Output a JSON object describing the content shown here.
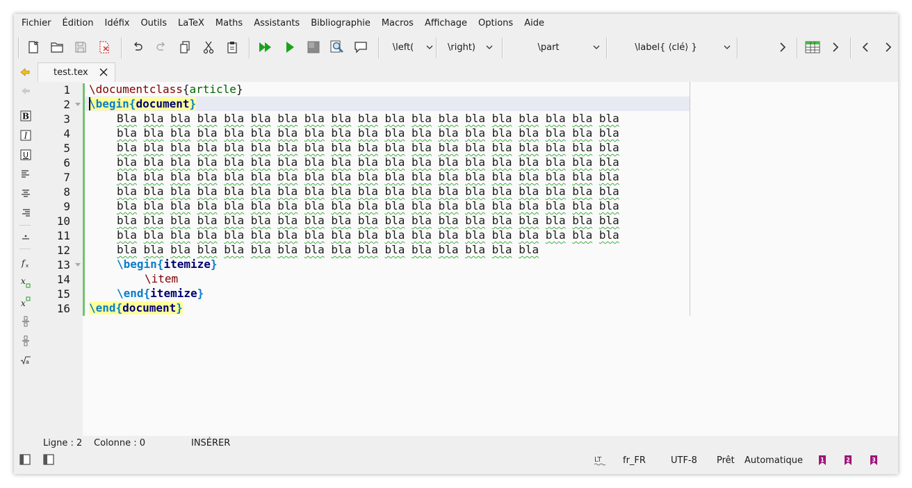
{
  "menu": [
    "Fichier",
    "Édition",
    "Idéfix",
    "Outils",
    "LaTeX",
    "Maths",
    "Assistants",
    "Bibliographie",
    "Macros",
    "Affichage",
    "Options",
    "Aide"
  ],
  "toolbar": {
    "combo_left": "\\left(",
    "combo_right": "\\right)",
    "combo_part": "\\part",
    "combo_label": "\\label{ ⟨clé⟩ }"
  },
  "tab": {
    "name": "test.tex"
  },
  "editor": {
    "line_numbers": [
      "1",
      "2",
      "3",
      "4",
      "5",
      "6",
      "7",
      "8",
      "9",
      "10",
      "11",
      "12",
      "13",
      "14",
      "15",
      "16"
    ],
    "word_first": "Bla",
    "word": "bla",
    "code": {
      "documentclass": "\\documentclass",
      "article": "article",
      "begin": "\\begin",
      "end": "\\end",
      "document": "document",
      "itemize": "itemize",
      "item": "\\item",
      "lbrace": "{",
      "rbrace": "}"
    }
  },
  "status": {
    "line": "Ligne : 2",
    "column": "Colonne : 0",
    "mode": "INSÉRER",
    "language": "fr_FR",
    "encoding": "UTF-8",
    "state": "Prêt",
    "auto": "Automatique",
    "bookmarks": [
      "1",
      "2",
      "3"
    ]
  },
  "colors": {
    "command": "#800000",
    "keyword": "#0a7dc9",
    "argument": "#006400",
    "env_name": "#000070",
    "highlight": "#ffff99",
    "spellcheck": "#3fae3f",
    "bookmark": "#a0147a",
    "run_green": "#1aa31a"
  },
  "icons": [
    "new-file-icon",
    "open-file-icon",
    "save-icon",
    "close-file-icon",
    "undo-icon",
    "redo-icon",
    "copy-icon",
    "cut-icon",
    "paste-icon",
    "build-view-icon",
    "compile-icon",
    "stop-icon",
    "view-pdf-icon",
    "log-icon",
    "table-icon"
  ]
}
